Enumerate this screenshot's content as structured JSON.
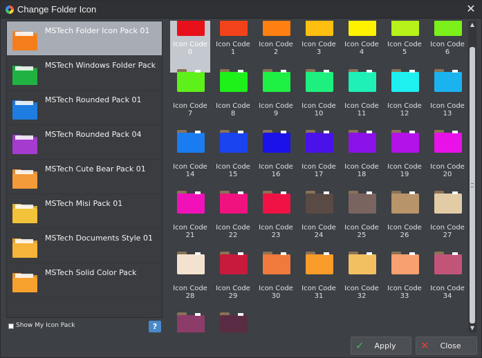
{
  "window": {
    "title": "Change Folder Icon"
  },
  "packs": [
    {
      "label": "MSTech Folder Icon Pack 01",
      "selected": true,
      "icon": "orange-folder-icon",
      "color": "#f47e1c"
    },
    {
      "label": "MSTech Windows Folder Pack",
      "selected": false,
      "icon": "green-windows-folder-icon",
      "color": "#21b342"
    },
    {
      "label": "MSTech Rounded Pack 01",
      "selected": false,
      "icon": "blue-rounded-folder-icon",
      "color": "#1e7de0"
    },
    {
      "label": "MSTech Rounded Pack 04",
      "selected": false,
      "icon": "purple-rounded-folder-icon",
      "color": "#a53ccf"
    },
    {
      "label": "MSTech Cute Bear Pack 01",
      "selected": false,
      "icon": "bear-folder-icon",
      "color": "#f39a3a"
    },
    {
      "label": "MSTech Misi Pack 01",
      "selected": false,
      "icon": "eye-folder-icon",
      "color": "#f2c23a"
    },
    {
      "label": "MSTech Documents Style 01",
      "selected": false,
      "icon": "documents-folder-icon",
      "color": "#f7b43a"
    },
    {
      "label": "MSTech Solid Color Pack",
      "selected": false,
      "icon": "solid-color-folder-icon",
      "color": "#f7a12e"
    }
  ],
  "show_my_pack": {
    "label": "Show My Icon Pack",
    "checked": false
  },
  "help": {
    "label": "?"
  },
  "icons": [
    {
      "line1": "Icon Code",
      "line2": "0",
      "color": "#e8101a",
      "selected": true
    },
    {
      "line1": "Icon Code",
      "line2": "1",
      "color": "#f2421a"
    },
    {
      "line1": "Icon Code",
      "line2": "2",
      "color": "#ff7f10"
    },
    {
      "line1": "Icon Code",
      "line2": "3",
      "color": "#ffbf10"
    },
    {
      "line1": "Icon Code",
      "line2": "4",
      "color": "#fff200"
    },
    {
      "line1": "Icon Code",
      "line2": "5",
      "color": "#b7f21a"
    },
    {
      "line1": "Icon Code",
      "line2": "6",
      "color": "#7cf01a"
    },
    {
      "line1": "Icon Code",
      "line2": "7",
      "color": "#5ef01a"
    },
    {
      "line1": "Icon Code",
      "line2": "8",
      "color": "#1ef01a"
    },
    {
      "line1": "Icon Code",
      "line2": "9",
      "color": "#1ef044"
    },
    {
      "line1": "Icon Code",
      "line2": "10",
      "color": "#1ef07f"
    },
    {
      "line1": "Icon Code",
      "line2": "11",
      "color": "#1ef0b8"
    },
    {
      "line1": "Icon Code",
      "line2": "12",
      "color": "#1ef0ef"
    },
    {
      "line1": "Icon Code",
      "line2": "13",
      "color": "#1ab3f0"
    },
    {
      "line1": "Icon Code",
      "line2": "14",
      "color": "#1a7cf0"
    },
    {
      "line1": "Icon Code",
      "line2": "15",
      "color": "#1a44f0"
    },
    {
      "line1": "Icon Code",
      "line2": "16",
      "color": "#1a12e8"
    },
    {
      "line1": "Icon Code",
      "line2": "17",
      "color": "#4a12e8"
    },
    {
      "line1": "Icon Code",
      "line2": "18",
      "color": "#8a12e8"
    },
    {
      "line1": "Icon Code",
      "line2": "19",
      "color": "#b312e8"
    },
    {
      "line1": "Icon Code",
      "line2": "20",
      "color": "#e812e8"
    },
    {
      "line1": "Icon Code",
      "line2": "21",
      "color": "#f012b8"
    },
    {
      "line1": "Icon Code",
      "line2": "22",
      "color": "#f0127f"
    },
    {
      "line1": "Icon Code",
      "line2": "23",
      "color": "#f01244"
    },
    {
      "line1": "Icon Code",
      "line2": "24",
      "color": "#5a4a44"
    },
    {
      "line1": "Icon Code",
      "line2": "25",
      "color": "#7a6460"
    },
    {
      "line1": "Icon Code",
      "line2": "26",
      "color": "#b8946a"
    },
    {
      "line1": "Icon Code",
      "line2": "27",
      "color": "#e2cca6"
    },
    {
      "line1": "Icon Code",
      "line2": "28",
      "color": "#f3e2d0"
    },
    {
      "line1": "Icon Code",
      "line2": "29",
      "color": "#c81a3c"
    },
    {
      "line1": "Icon Code",
      "line2": "30",
      "color": "#f07a3c"
    },
    {
      "line1": "Icon Code",
      "line2": "31",
      "color": "#f89c2a"
    },
    {
      "line1": "Icon Code",
      "line2": "32",
      "color": "#f2c060"
    },
    {
      "line1": "Icon Code",
      "line2": "33",
      "color": "#f8a070"
    },
    {
      "line1": "Icon Code",
      "line2": "34",
      "color": "#c25478"
    },
    {
      "line1": "",
      "line2": "",
      "color": "#8c3c68"
    },
    {
      "line1": "",
      "line2": "",
      "color": "#5a2c44"
    }
  ],
  "buttons": {
    "apply": "Apply",
    "close": "Close"
  },
  "icon_names": {
    "apply": "checkmark-icon",
    "close": "x-icon"
  }
}
